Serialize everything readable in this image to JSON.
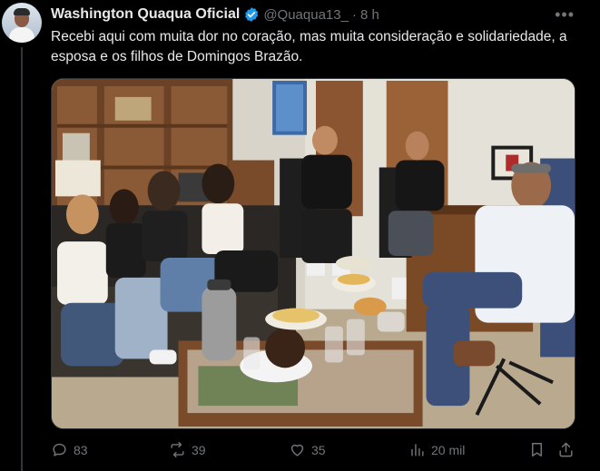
{
  "post": {
    "display_name": "Washington Quaqua Oficial",
    "handle": "@Quaqua13_",
    "separator": "·",
    "time": "8 h",
    "more_label": "•••",
    "text": "Recebi aqui com muita dor no coração, mas muita consideração e solidariedade, a esposa e os filhos de Domingos Brazão.",
    "verified_icon": "verified-badge-icon",
    "photo_icon": "group-photo-office"
  },
  "actions": {
    "replies": "83",
    "reposts": "39",
    "likes": "35",
    "views": "20 mil"
  },
  "colors": {
    "background": "#000000",
    "text": "#e7e9ea",
    "muted": "#71767b",
    "verified": "#1d9bf0",
    "divider": "#333639"
  }
}
